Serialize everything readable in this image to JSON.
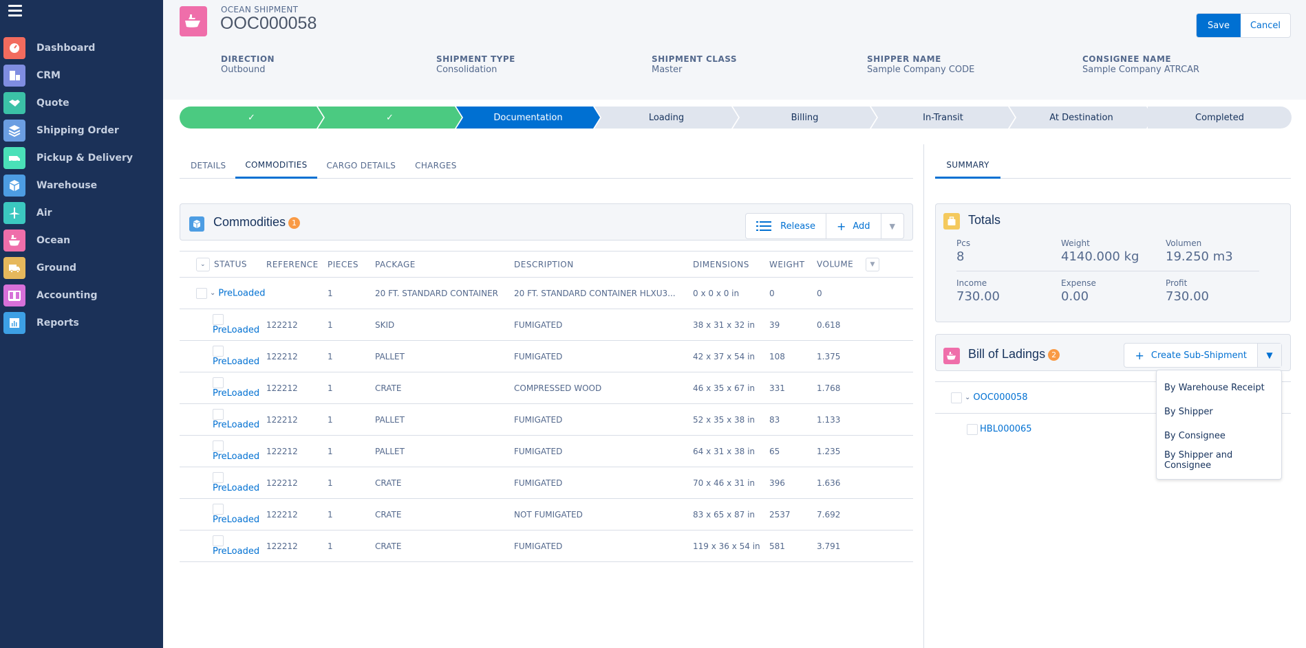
{
  "sidebar": {
    "items": [
      {
        "label": "Dashboard",
        "icon": "dashboard-icon",
        "color": "#f26b5e"
      },
      {
        "label": "CRM",
        "icon": "buildings-icon",
        "color": "#7f8de1"
      },
      {
        "label": "Quote",
        "icon": "handshake-icon",
        "color": "#3bc1a7"
      },
      {
        "label": "Shipping Order",
        "icon": "layers-icon",
        "color": "#6b9ee2"
      },
      {
        "label": "Pickup & Delivery",
        "icon": "van-icon",
        "color": "#4ae0b8"
      },
      {
        "label": "Warehouse",
        "icon": "box-icon",
        "color": "#4d9de3"
      },
      {
        "label": "Air",
        "icon": "plane-icon",
        "color": "#3bc8c0"
      },
      {
        "label": "Ocean",
        "icon": "ship-icon",
        "color": "#ef6eaa"
      },
      {
        "label": "Ground",
        "icon": "truck-icon",
        "color": "#e6b85c"
      },
      {
        "label": "Accounting",
        "icon": "book-icon",
        "color": "#d770d9"
      },
      {
        "label": "Reports",
        "icon": "bar-chart-icon",
        "color": "#3da0e5"
      }
    ]
  },
  "header": {
    "object_type": "OCEAN SHIPMENT",
    "title": "OOC000058",
    "save_label": "Save",
    "cancel_label": "Cancel",
    "fields": [
      {
        "label": "DIRECTION",
        "value": "Outbound"
      },
      {
        "label": "SHIPMENT TYPE",
        "value": "Consolidation"
      },
      {
        "label": "SHIPMENT CLASS",
        "value": "Master"
      },
      {
        "label": "SHIPPER NAME",
        "value": "Sample Company CODE"
      },
      {
        "label": "CONSIGNEE NAME",
        "value": "Sample Company ATRCAR"
      }
    ]
  },
  "path": {
    "stages": [
      {
        "label": "✓",
        "state": "complete"
      },
      {
        "label": "✓",
        "state": "complete"
      },
      {
        "label": "Documentation",
        "state": "current"
      },
      {
        "label": "Loading",
        "state": "incomplete"
      },
      {
        "label": "Billing",
        "state": "incomplete"
      },
      {
        "label": "In-Transit",
        "state": "incomplete"
      },
      {
        "label": "At Destination",
        "state": "incomplete"
      },
      {
        "label": "Completed",
        "state": "incomplete"
      }
    ]
  },
  "tabs": [
    {
      "label": "DETAILS",
      "active": false
    },
    {
      "label": "COMMODITIES",
      "active": true
    },
    {
      "label": "CARGO DETAILS",
      "active": false
    },
    {
      "label": "CHARGES",
      "active": false
    }
  ],
  "commodities": {
    "title": "Commodities",
    "count": "1",
    "release_label": "Release",
    "add_label": "Add",
    "columns": [
      "STATUS",
      "REFERENCE",
      "PIECES",
      "PACKAGE",
      "DESCRIPTION",
      "DIMENSIONS",
      "WEIGHT",
      "VOLUME"
    ],
    "parent": {
      "status": "PreLoaded",
      "reference": "",
      "pieces": "1",
      "package": "20 FT. STANDARD CONTAINER",
      "description": "20 FT. STANDARD CONTAINER HLXU3...",
      "dimensions": "0 x 0 x 0 in",
      "weight": "0",
      "volume": "0"
    },
    "rows": [
      {
        "status": "PreLoaded",
        "reference": "122212",
        "pieces": "1",
        "package": "SKID",
        "description": "FUMIGATED",
        "dimensions": "38 x 31 x 32 in",
        "weight": "39",
        "volume": "0.618"
      },
      {
        "status": "PreLoaded",
        "reference": "122212",
        "pieces": "1",
        "package": "PALLET",
        "description": "FUMIGATED",
        "dimensions": "42 x 37 x 54 in",
        "weight": "108",
        "volume": "1.375"
      },
      {
        "status": "PreLoaded",
        "reference": "122212",
        "pieces": "1",
        "package": "CRATE",
        "description": "COMPRESSED WOOD",
        "dimensions": "46 x 35 x 67 in",
        "weight": "331",
        "volume": "1.768"
      },
      {
        "status": "PreLoaded",
        "reference": "122212",
        "pieces": "1",
        "package": "PALLET",
        "description": "FUMIGATED",
        "dimensions": "52 x 35 x 38 in",
        "weight": "83",
        "volume": "1.133"
      },
      {
        "status": "PreLoaded",
        "reference": "122212",
        "pieces": "1",
        "package": "PALLET",
        "description": "FUMIGATED",
        "dimensions": "64 x 31 x 38 in",
        "weight": "65",
        "volume": "1.235"
      },
      {
        "status": "PreLoaded",
        "reference": "122212",
        "pieces": "1",
        "package": "CRATE",
        "description": "FUMIGATED",
        "dimensions": "70 x 46 x 31 in",
        "weight": "396",
        "volume": "1.636"
      },
      {
        "status": "PreLoaded",
        "reference": "122212",
        "pieces": "1",
        "package": "CRATE",
        "description": "NOT FUMIGATED",
        "dimensions": "83 x 65 x 87 in",
        "weight": "2537",
        "volume": "7.692"
      },
      {
        "status": "PreLoaded",
        "reference": "122212",
        "pieces": "1",
        "package": "CRATE",
        "description": "FUMIGATED",
        "dimensions": "119 x 36 x 54 in",
        "weight": "581",
        "volume": "3.791"
      }
    ]
  },
  "summary": {
    "tab_label": "SUMMARY",
    "totals": {
      "title": "Totals",
      "pcs_label": "Pcs",
      "pcs": "8",
      "weight_label": "Weight",
      "weight": "4140.000 kg",
      "volume_label": "Volumen",
      "volume": "19.250 m3",
      "income_label": "Income",
      "income": "730.00",
      "expense_label": "Expense",
      "expense": "0.00",
      "profit_label": "Profit",
      "profit": "730.00"
    },
    "bol": {
      "title": "Bill of Ladings",
      "count": "2",
      "create_label": "Create Sub-Shipment",
      "items": [
        "OOC000058",
        "HBL000065"
      ],
      "menu": [
        "By Warehouse Receipt",
        "By Shipper",
        "By Consignee",
        "By Shipper and Consignee"
      ]
    }
  },
  "colors": {
    "sidebar_bg": "#1b3158",
    "brand_blue": "#0070d2",
    "complete_green": "#4bca81",
    "badge_orange": "#f99a45"
  }
}
